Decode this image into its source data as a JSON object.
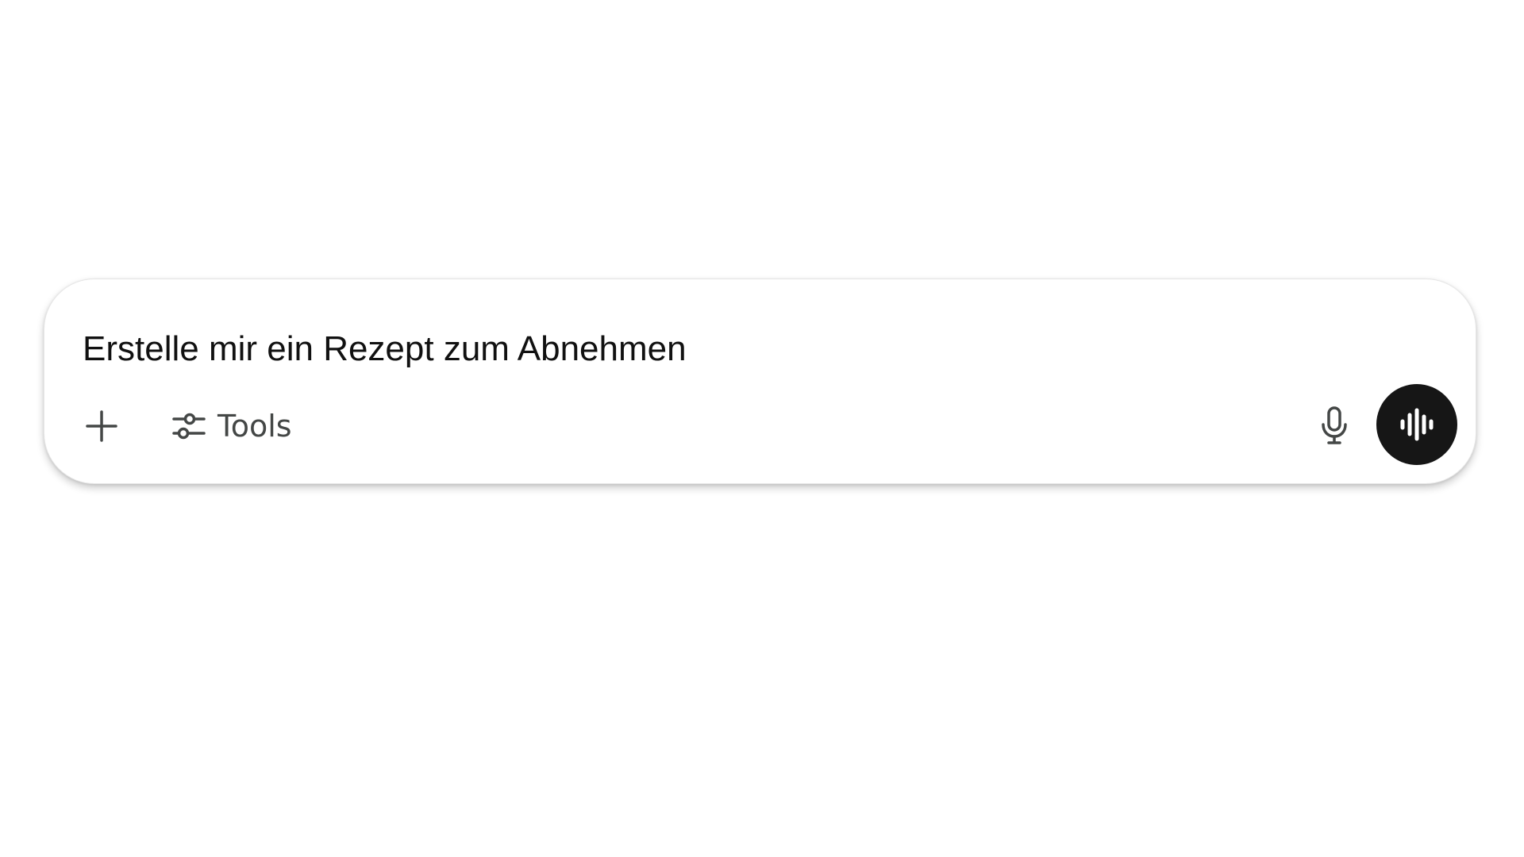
{
  "composer": {
    "prompt_text": "Erstelle mir ein Rezept zum Abnehmen",
    "add_icon": "plus-icon",
    "tools_icon": "sliders-icon",
    "tools_label": "Tools",
    "mic_icon": "microphone-icon",
    "voice_icon": "audio-waveform-icon"
  },
  "colors": {
    "background": "#ffffff",
    "text": "#111111",
    "icon": "#444746",
    "voice_button": "#161616"
  }
}
